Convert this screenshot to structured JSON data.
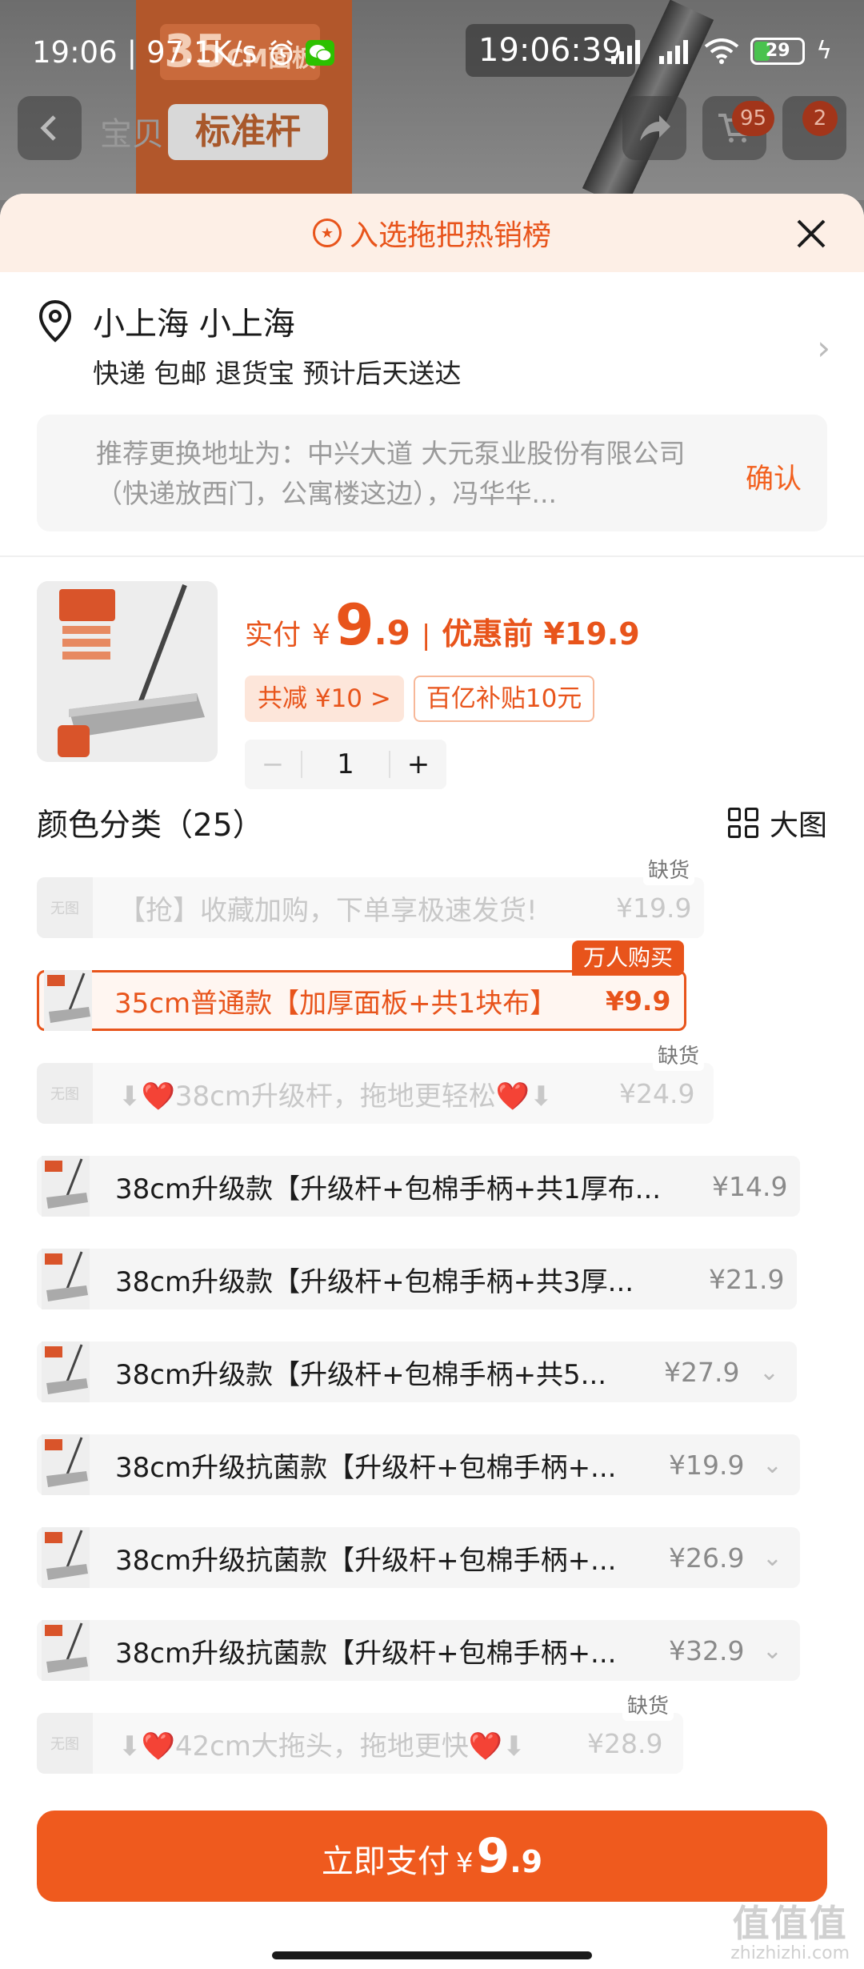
{
  "status_bar": {
    "time": "19:06",
    "speed": "97.1K/s",
    "clock_overlay": "19:06:39",
    "battery": "29"
  },
  "background": {
    "product_size": "35",
    "product_unit": "CM面板",
    "product_text": "标准杆",
    "title_partial": "宝贝",
    "cart_badge": "95",
    "msg_badge": "2"
  },
  "banner": {
    "text": "入选拖把热销榜"
  },
  "address": {
    "name": "小上海 小上海",
    "delivery": "快递 包邮 退货宝 预计后天送达",
    "recommend": "推荐更换地址为：中兴大道 大元泵业股份有限公司（快递放西门，公寓楼这边），冯华华...",
    "confirm_label": "确认"
  },
  "product": {
    "pay_label": "实付",
    "currency": "¥",
    "price_int": "9",
    "price_dec": ".9",
    "sep": "|",
    "original_label": "优惠前 ¥19.9",
    "discount_tag": "共减 ¥10 >",
    "subsidy_tag": "百亿补贴10元",
    "quantity": "1",
    "minus": "−",
    "plus": "+"
  },
  "category": {
    "title": "颜色分类（25）",
    "big_view_label": "大图"
  },
  "variants": [
    {
      "name": "【抢】收藏加购，下单享极速发货!",
      "price": "¥19.9",
      "state": "disabled",
      "badge": "缺货",
      "thumb": "无图"
    },
    {
      "name": "35cm普通款【加厚面板+共1块布】",
      "price": "¥9.9",
      "state": "selected",
      "badge": "万人购买"
    },
    {
      "name": "⬇❤️38cm升级杆，拖地更轻松❤️⬇",
      "price": "¥24.9",
      "state": "disabled",
      "badge": "缺货",
      "thumb": "无图"
    },
    {
      "name": "38cm升级款【升级杆+包棉手柄+共1厚布...",
      "price": "¥14.9",
      "state": "normal"
    },
    {
      "name": "38cm升级款【升级杆+包棉手柄+共3厚...",
      "price": "¥21.9",
      "state": "normal"
    },
    {
      "name": "38cm升级款【升级杆+包棉手柄+共5...",
      "price": "¥27.9",
      "state": "normal"
    },
    {
      "name": "38cm升级抗菌款【升级杆+包棉手柄+...",
      "price": "¥19.9",
      "state": "normal"
    },
    {
      "name": "38cm升级抗菌款【升级杆+包棉手柄+...",
      "price": "¥26.9",
      "state": "normal"
    },
    {
      "name": "38cm升级抗菌款【升级杆+包棉手柄+...",
      "price": "¥32.9",
      "state": "normal"
    },
    {
      "name": "⬇❤️42cm大拖头，拖地更快❤️⬇",
      "price": "¥28.9",
      "state": "disabled",
      "badge": "缺货",
      "thumb": "无图"
    }
  ],
  "pay_button": {
    "label": "立即支付",
    "currency": "¥",
    "int": "9",
    "dec": ".9"
  },
  "watermark": {
    "big": "值值值",
    "small": "zhizhizhi.com"
  },
  "colors": {
    "accent": "#e8541b",
    "pay_button": "#ef5a1e",
    "banner_bg": "#fdefe6"
  }
}
